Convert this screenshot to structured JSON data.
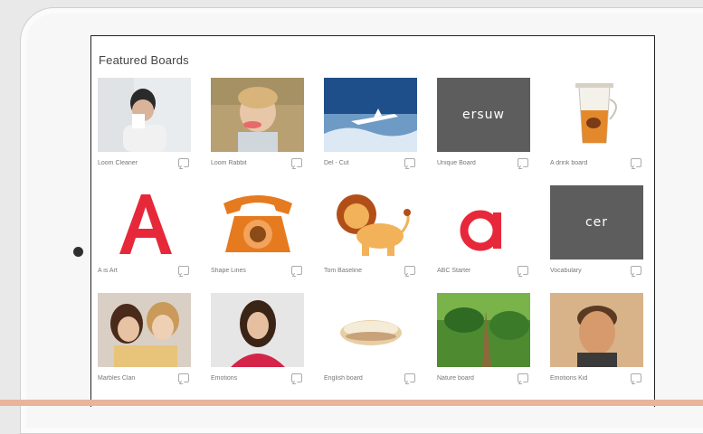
{
  "header": {
    "title": "Featured Boards"
  },
  "boards": [
    {
      "caption": "Loom Cleaner"
    },
    {
      "caption": "Loom Rabbit"
    },
    {
      "caption": "Del - Cut"
    },
    {
      "caption": "Unique Board",
      "thumb_text": "ersuw"
    },
    {
      "caption": "A drink board"
    },
    {
      "caption": "A is Art"
    },
    {
      "caption": "Shape Lines"
    },
    {
      "caption": "Tom Baseline"
    },
    {
      "caption": "ABC Starter"
    },
    {
      "caption": "Vocabulary",
      "thumb_text": "cer"
    },
    {
      "caption": "Marbles Clan"
    },
    {
      "caption": "Emotions"
    },
    {
      "caption": "English board"
    },
    {
      "caption": "Nature board"
    },
    {
      "caption": "Emotions Kid"
    }
  ],
  "colors": {
    "accent": "#e6283a",
    "dark_tile": "#5d5d5d",
    "phone": "#e67a1f"
  }
}
